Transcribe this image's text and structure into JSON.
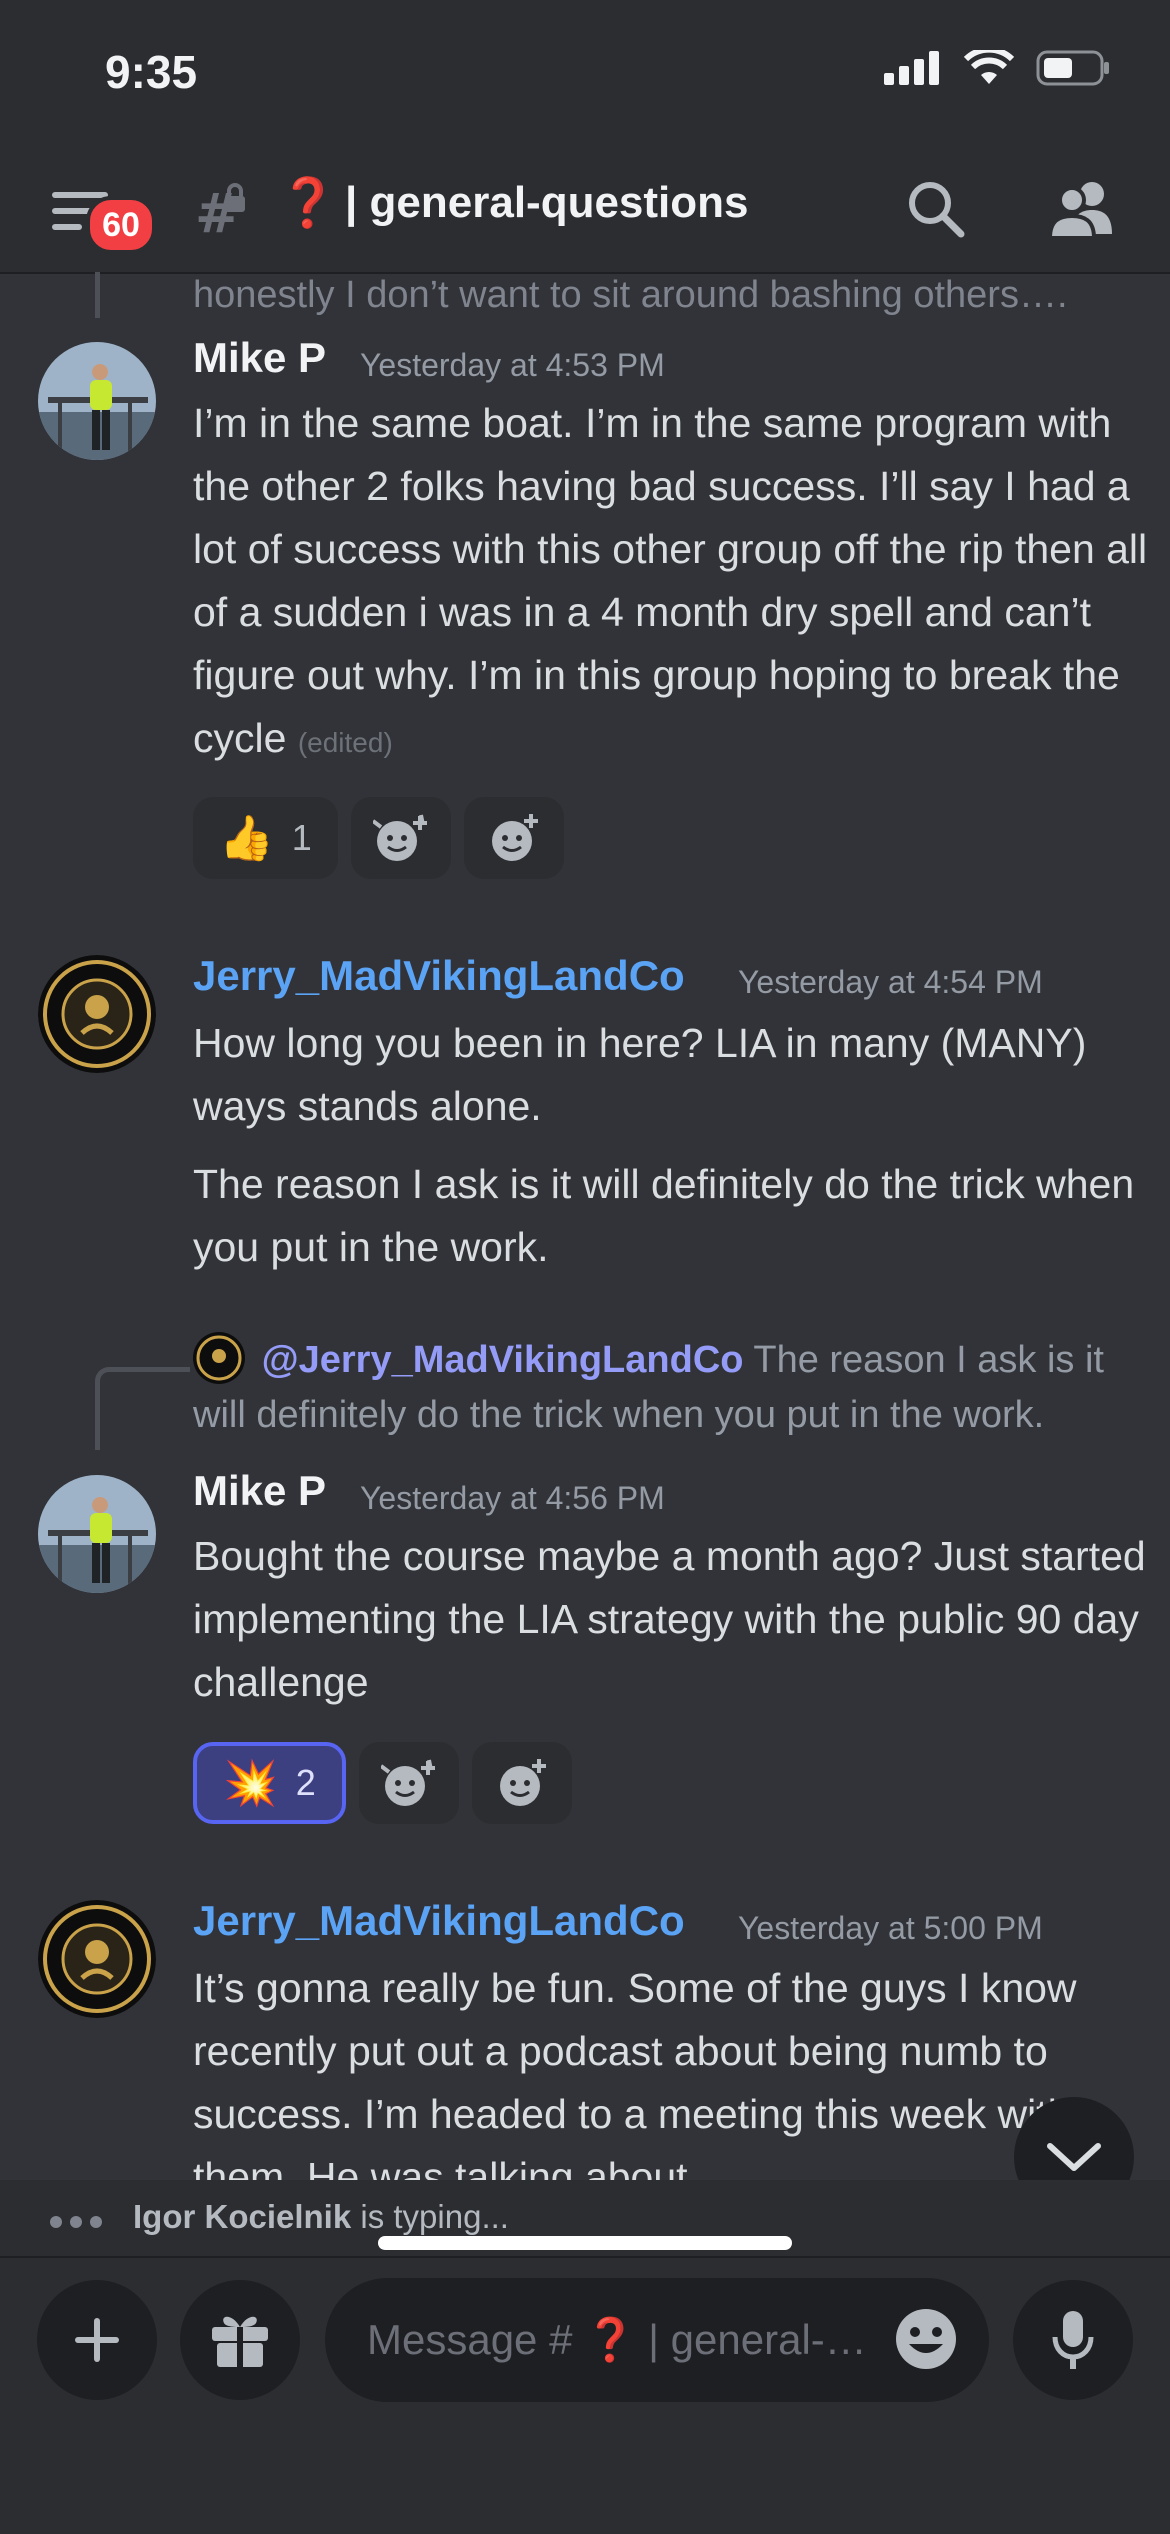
{
  "status_bar": {
    "time": "9:35"
  },
  "header": {
    "badge_count": "60",
    "channel_emoji": "❓",
    "channel_name": "| general-questions"
  },
  "messages": {
    "cutoff_text": "honestly I don’t want to sit around bashing others….",
    "m1": {
      "author": "Mike P",
      "author_color": "#f2f3f5",
      "time": "Yesterday at 4:53 PM",
      "text": "I’m in the same boat. I’m in the same program with the other 2 folks having bad success. I’ll say I had a lot of success with this other group off the rip then all of a sudden i was in a 4 month dry spell and can’t figure out why. I’m in this group hoping to break the cycle",
      "edited": "(edited)",
      "reaction_emoji": "👍",
      "reaction_count": "1"
    },
    "m2": {
      "author": "Jerry_MadVikingLandCo",
      "author_color": "#5ba3f5",
      "time": "Yesterday at 4:54 PM",
      "text1": "How long you been in here? LIA in many (MANY) ways stands alone.",
      "text2": "The reason I ask is it will definitely do the trick when you put in the work."
    },
    "m3": {
      "reply_mention": "@Jerry_MadVikingLandCo",
      "reply_text": "The reason I ask is it will definitely do the trick when you put in the work.",
      "author": "Mike P",
      "time": "Yesterday at 4:56 PM",
      "text": "Bought the course maybe a month ago? Just started implementing the LIA strategy with the public 90 day challenge",
      "reaction_emoji": "💥",
      "reaction_count": "2"
    },
    "m4": {
      "author": "Jerry_MadVikingLandCo",
      "time": "Yesterday at 5:00 PM",
      "text": "It’s gonna really be fun.  Some of the guys I know recently put out a podcast about being numb to success.  I’m headed to a meeting this week with them.  He was talking about"
    }
  },
  "typing": {
    "user": "Igor Kocielnik",
    "suffix": " is typing..."
  },
  "composer": {
    "placeholder": "Message # ❓ | general-questions"
  },
  "icons": [
    "hamburger-icon",
    "locked-channel-icon",
    "search-icon",
    "members-icon",
    "add-reaction-icon",
    "add-super-reaction-icon",
    "chevron-down-icon",
    "plus-icon",
    "gift-icon",
    "emoji-icon",
    "microphone-icon"
  ]
}
